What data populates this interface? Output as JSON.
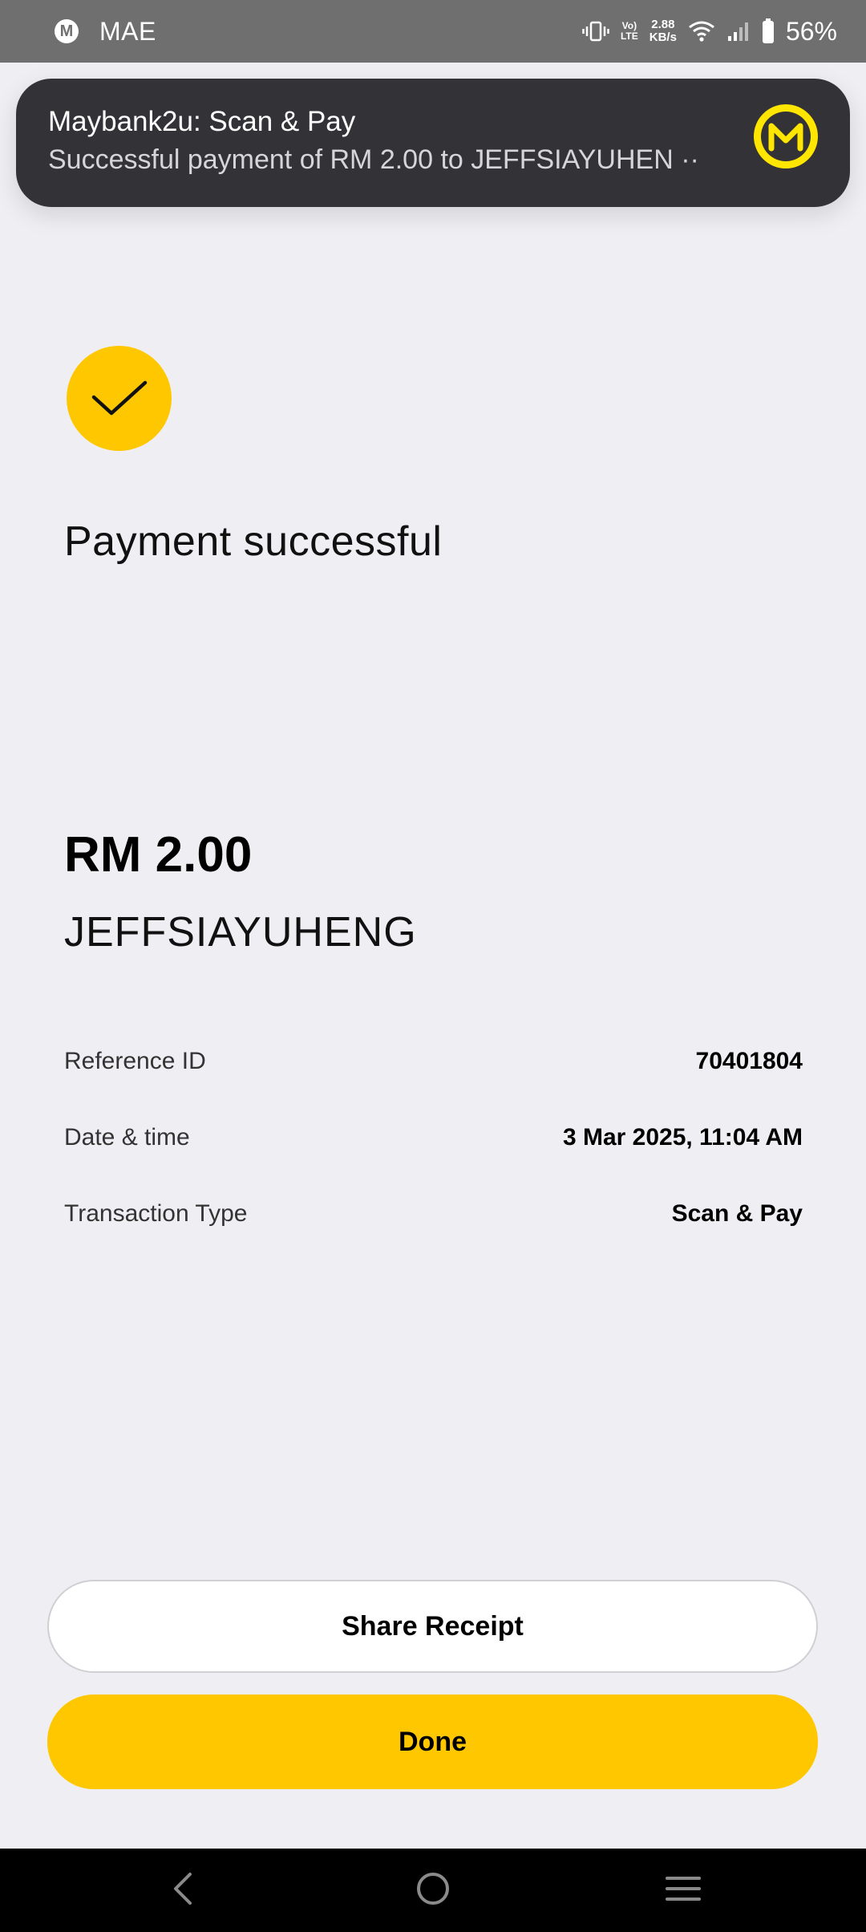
{
  "status_bar": {
    "app_name": "MAE",
    "app_icon_letter": "M",
    "network_speed_value": "2.88",
    "network_speed_unit": "KB/s",
    "volte_top": "Vo)",
    "volte_bottom": "LTE",
    "battery_percent": "56%"
  },
  "notification": {
    "title": "Maybank2u: Scan & Pay",
    "body": "Successful payment of RM 2.00 to JEFFSIAYUHEN ··",
    "logo_letter": "M",
    "logo_color": "#ffe600"
  },
  "receipt": {
    "status_title": "Payment successful",
    "amount": "RM 2.00",
    "recipient": "JEFFSIAYUHENG",
    "details": [
      {
        "label": "Reference ID",
        "value": "70401804"
      },
      {
        "label": "Date & time",
        "value": "3 Mar 2025, 11:04 AM"
      },
      {
        "label": "Transaction Type",
        "value": "Scan & Pay"
      }
    ]
  },
  "actions": {
    "share_label": "Share Receipt",
    "done_label": "Done"
  },
  "colors": {
    "accent": "#ffc700",
    "background": "#efeff3",
    "notification_bg": "#333236"
  },
  "icons": {
    "success": "checkmark-icon",
    "nav_back": "back-chevron-icon",
    "nav_home": "home-circle-icon",
    "nav_recents": "recents-menu-icon"
  }
}
